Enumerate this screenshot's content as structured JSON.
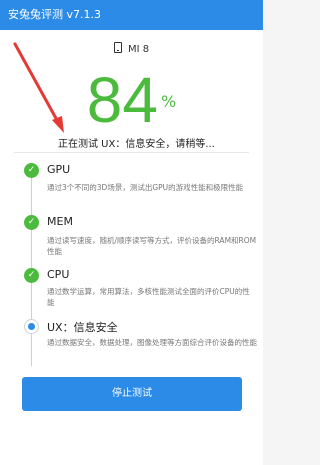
{
  "app": {
    "title": "安兔兔评测 v7.1.3"
  },
  "device": {
    "icon": "phone-icon",
    "name": "MI 8"
  },
  "progress": {
    "value": "84",
    "unit": "%",
    "status": "正在测试 UX：信息安全，请稍等..."
  },
  "items": [
    {
      "title": "GPU",
      "desc": "通过3个不同的3D场景，测试出GPU的游戏性能和极限性能",
      "state": "done"
    },
    {
      "title": "MEM",
      "desc": "通过读写速度，随机/顺序读写等方式，评价设备的RAM和ROM性能",
      "state": "done"
    },
    {
      "title": "CPU",
      "desc": "通过数学运算，常用算法，多核性能测试全面的评价CPU的性能",
      "state": "done"
    },
    {
      "title": "UX：信息安全",
      "desc": "通过数据安全，数据处理，图像处理等方面综合评价设备的性能",
      "state": "running"
    }
  ],
  "actions": {
    "stop": "停止测试"
  },
  "colors": {
    "accent": "#2b8be6",
    "success": "#4cbb3d",
    "annotation": "#e53935"
  }
}
